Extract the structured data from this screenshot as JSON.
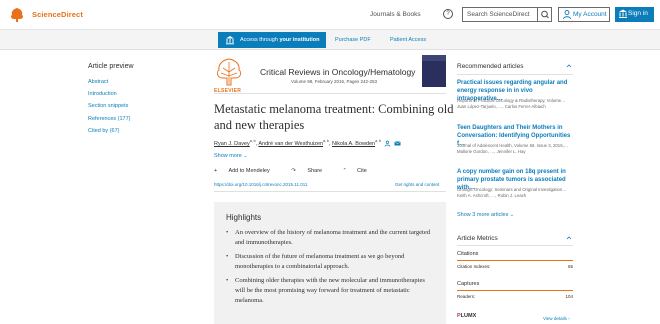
{
  "header": {
    "brand": "ScienceDirect",
    "journals_books": "Journals & Books",
    "help": "?",
    "search_label": "Search ScienceDirect",
    "my_account": "My Account",
    "sign_in": "Sign in"
  },
  "access_bar": {
    "access_prefix": "Access through ",
    "access_bold": "your institution",
    "purchase_pdf": "Purchase PDF",
    "patient_access": "Patient Access"
  },
  "preview": {
    "title": "Article preview",
    "items": [
      "Abstract",
      "Introduction",
      "Section snippets",
      "References (177)",
      "Cited by (67)"
    ]
  },
  "journal": {
    "publisher": "ELSEVIER",
    "title": "Critical Reviews in Oncology/Hematology",
    "volume": "Volume 98, February 2016, Pages 242-253"
  },
  "article": {
    "title": "Metastatic melanoma treatment: Combining old and new therapies",
    "authors": [
      "Ryan J. Davey",
      "André van der Westhuizen",
      "Nikola A. Bowden"
    ],
    "author_marks": [
      "a, b",
      "a, b",
      "a, b"
    ],
    "show_more": "Show more",
    "add_mendeley": "Add to Mendeley",
    "share": "Share",
    "cite": "Cite",
    "doi": "https://doi.org/10.1016/j.critrevonc.2015.11.011",
    "rights": "Get rights and content"
  },
  "highlights": {
    "title": "Highlights",
    "items": [
      "An overview of the history of melanoma treatment and the current targeted and immunotherapies.",
      "Discussion of the future of melanoma treatment as we go beyond monotherapies to a combinatorial approach.",
      "Combining older therapies with the new molecular and immunotherapies will be the most promising way forward for treatment of metastatic melanoma."
    ]
  },
  "recommended": {
    "title": "Recommended articles",
    "items": [
      {
        "title": "Practical issues regarding angular and energy response in in vivo intraoperative…",
        "journal": "Reports of Practical Oncology & Radiotherapy, Volume…",
        "authors": "Juan López-Tarjuelo, …, Carlos Ferrer-Albiach"
      },
      {
        "title": "Teen Daughters and Their Mothers in Conversation: Identifying Opportunities f…",
        "journal": "Journal of Adolescent Health, Volume 58, Issue 3, 2016,…",
        "authors": "Mallorie Gordon, …, Jennifer L. Hay"
      },
      {
        "title": "A copy number gain on 18q present in primary prostate tumors is associated with…",
        "journal": "Urologic Oncology: Seminars and Original Investigation…",
        "authors": "Keith A. Ashcroft, …, Robin J. Leach"
      }
    ],
    "show_more": "Show 3 more articles"
  },
  "metrics": {
    "title": "Article Metrics",
    "categories": [
      {
        "name": "Citations",
        "row_label": "Citation Indexes:",
        "value": "65"
      },
      {
        "name": "Captures",
        "row_label": "Readers:",
        "value": "104"
      }
    ],
    "plumx_p": "P",
    "plumx_rest": "LUMX",
    "view_details": "View details"
  },
  "colors": {
    "brand_orange": "#e9711c",
    "link_blue": "#0c7dbb"
  }
}
